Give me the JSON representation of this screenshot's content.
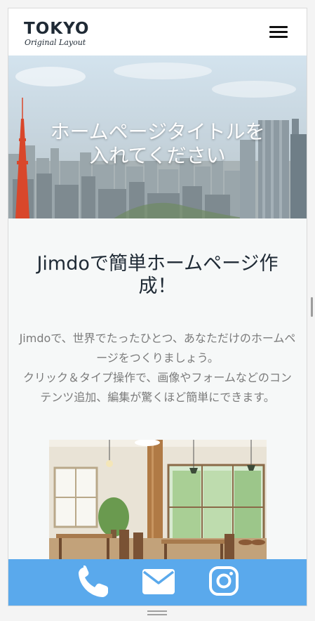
{
  "header": {
    "logo_main": "TOKYO",
    "logo_sub": "Original Layout",
    "menu_icon": "hamburger-icon"
  },
  "hero": {
    "title_line1": "ホームページタイトルを",
    "title_line2": "入れてください"
  },
  "main": {
    "headline": "Jimdoで簡単ホームページ作成！",
    "intro_line1": "Jimdoで、世界でたったひとつ、あなただけのホームページをつくりましょう。",
    "intro_line2": "クリック＆タイプ操作で、画像やフォームなどのコンテンツ追加、編集が驚くほど簡単にできます。"
  },
  "action_bar": {
    "background": "#5aa9ec",
    "icons": [
      "phone-icon",
      "mail-icon",
      "instagram-icon"
    ]
  },
  "colors": {
    "text_dark": "#1f2a35",
    "text_gray": "#7b7b7b",
    "page_bg": "#f6f8f8"
  }
}
